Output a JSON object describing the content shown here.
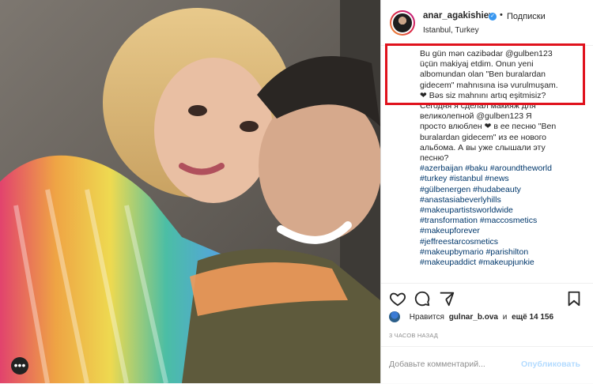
{
  "header": {
    "username": "anar_agakishiev",
    "dot": "•",
    "follow_label": "Подписки",
    "location": "Istanbul, Turkey"
  },
  "caption": {
    "highlighted_lines": [
      "Bu gün mən cazibədar @gulben123",
      "üçün makiyaj etdim. Onun yeni",
      "albomundan olan \"Ben buralardan",
      "gidecem\" mahnısına isə vurulmuşam.",
      "❤ Bəs siz mahnını artıq eşitmisiz?"
    ],
    "ru_lines": [
      "Сегодня я сделал макияж для",
      "великолепной @gulben123 Я",
      "просто влюблен ❤ в ее песню \"Ben",
      "buralardan gidecem\" из ее нового",
      "альбома. А вы уже слышали эту",
      "песню?"
    ],
    "hashtag_lines": [
      "#azerbaijan #baku #aroundtheworld",
      "#turkey #istanbul #news",
      "#gülbenergen #hudabeauty",
      "#anastasiabeverlyhills",
      "#makeupartistsworldwide",
      "#transformation #maccosmetics",
      "#makeupforever",
      "#jeffreestarcosmetics",
      "#makeupbymario #parishilton",
      "#makeupaddict #makeupjunkie"
    ]
  },
  "likes": {
    "prefix": "Нравится",
    "user": "gulnar_b.ova",
    "middle": "и",
    "count_text": "ещё 14 156"
  },
  "timestamp": "3 ЧАСОВ НАЗАД",
  "comment": {
    "placeholder": "Добавьте комментарий...",
    "post_label": "Опубликовать"
  },
  "icons": {
    "like": "heart-icon",
    "comment": "comment-icon",
    "share": "share-icon",
    "save": "bookmark-icon",
    "more": "more-dots-icon"
  },
  "colors": {
    "highlight_box": "#e0121d",
    "link": "#00376b",
    "verified": "#3897f0"
  }
}
